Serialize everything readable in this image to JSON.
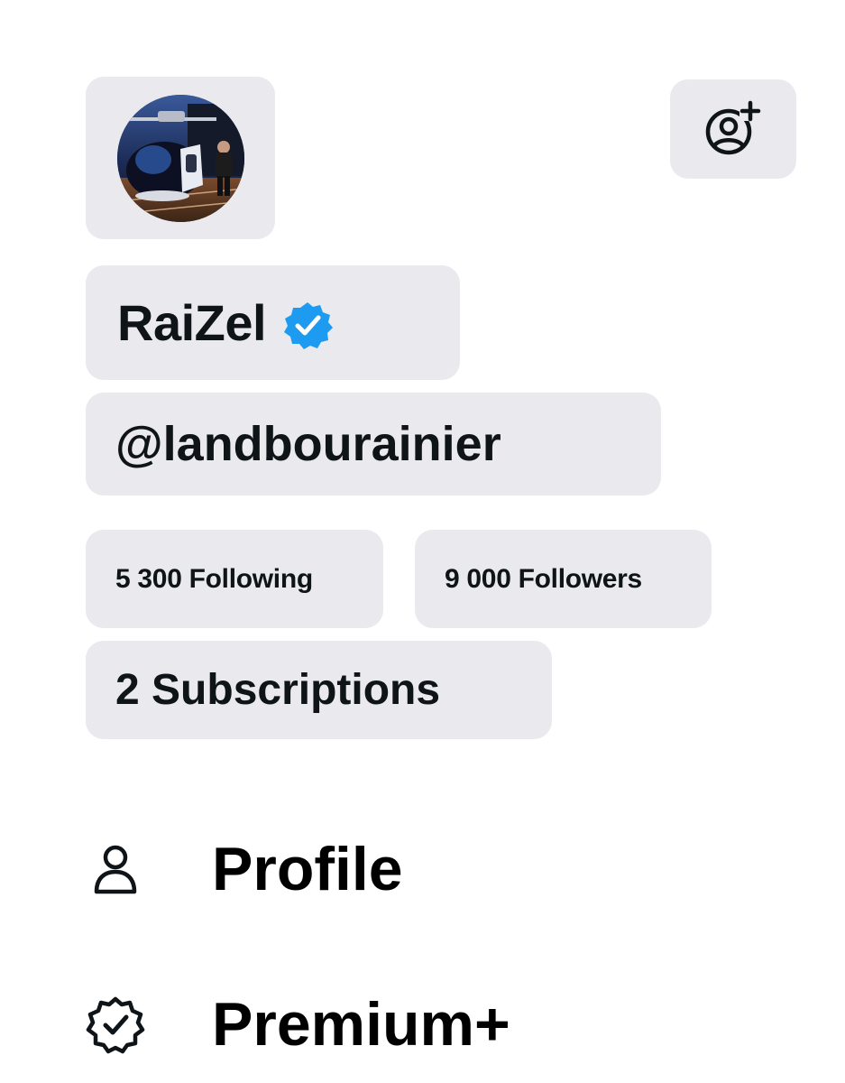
{
  "profile": {
    "display_name": "RaiZel",
    "handle": "@landbourainier",
    "verified": true,
    "avatar_icon": "profile-photo-helicopter"
  },
  "stats": {
    "following_label": "5 300 Following",
    "followers_label": "9 000 Followers",
    "subscriptions_label": "2 Subscriptions"
  },
  "header": {
    "add_account_icon": "add-account-icon"
  },
  "menu": {
    "items": [
      {
        "label": "Profile",
        "icon": "person-icon"
      },
      {
        "label": "Premium+",
        "icon": "verified-outline-icon"
      }
    ]
  },
  "colors": {
    "card_bg": "#e9e9ee",
    "verified_blue": "#1d9bf0",
    "text": "#0f1419"
  }
}
